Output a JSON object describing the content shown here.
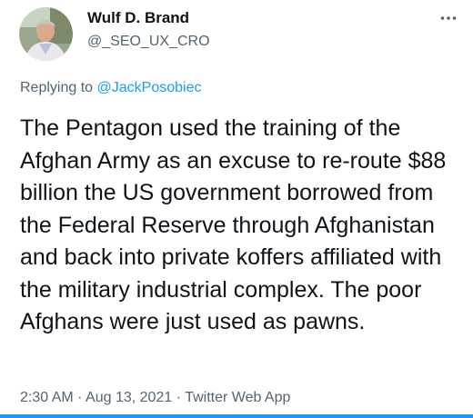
{
  "author": {
    "display_name": "Wulf D. Brand",
    "handle": "@_SEO_UX_CRO"
  },
  "reply": {
    "prefix": "Replying to ",
    "to_handle": "@JackPosobiec"
  },
  "tweet": {
    "text": "The Pentagon used the training of the Afghan Army as an excuse to re-route $88 billion the US government borrowed from the Federal Reserve through Afghanistan and back into private koffers affiliated with the military industrial complex. The poor Afghans were just used as pawns."
  },
  "meta": {
    "time": "2:30 AM",
    "sep1": " · ",
    "date": "Aug 13, 2021",
    "sep2": " · ",
    "source": "Twitter Web App"
  },
  "icons": {
    "more": "more-horizontal-icon",
    "avatar": "avatar-image"
  },
  "colors": {
    "accent": "#1d9bf0",
    "text_primary": "#0f1419",
    "text_secondary": "#536471",
    "background": "#ffffff"
  }
}
